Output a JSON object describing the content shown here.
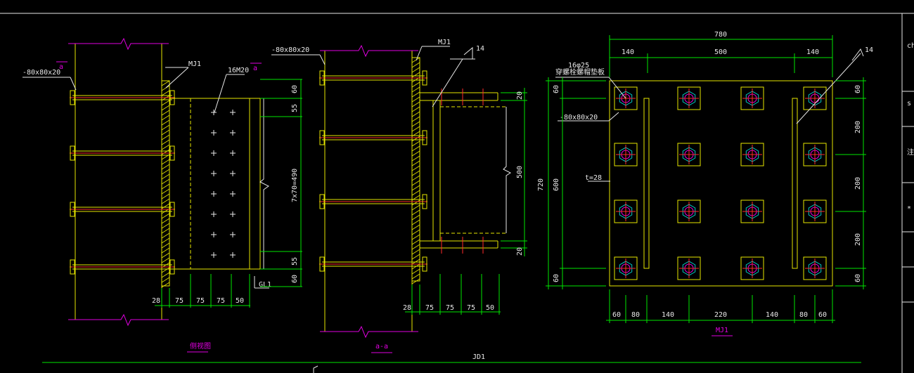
{
  "colors": {
    "yellow": "#e6e600",
    "green": "#00e600",
    "magenta": "#e000e0",
    "red": "#ff2a2a",
    "white": "#e8e8e8",
    "cyan": "#00c8c8"
  },
  "title": "JD1",
  "left_view": {
    "caption": "侧视图",
    "plate_label": "-80x80x20",
    "section_mark": "a",
    "mj_label": "MJ1",
    "bolt_label": "16M20",
    "gl_label": "GL1",
    "dim_right": [
      "60",
      "55",
      "7x70=490",
      "55",
      "60"
    ],
    "dim_bottom": [
      "28",
      "75",
      "75",
      "75",
      "50"
    ]
  },
  "middle_view": {
    "caption": "a-a",
    "plate_label": "-80x80x20",
    "mj_label": "MJ1",
    "weld_label": "14",
    "dim_right": [
      "20",
      "500",
      "20"
    ],
    "dim_bottom": [
      "28",
      "75",
      "75",
      "75",
      "50"
    ]
  },
  "right_view": {
    "caption": "MJ1",
    "top_total": "780",
    "top_dims": [
      "140",
      "500",
      "140"
    ],
    "bolt_note": "16φ25",
    "bolt_note2": "穿螺栓螺帽垫板",
    "plate_label": "-80x80x20",
    "rib_label": "t=28",
    "weld_label": "14",
    "left_total": "720",
    "left_dims": [
      "60",
      "600",
      "60"
    ],
    "right_dims": [
      "60",
      "200",
      "200",
      "200",
      "60"
    ],
    "bottom_dims": [
      "60",
      "80",
      "140",
      "220",
      "140",
      "80",
      "60"
    ]
  }
}
